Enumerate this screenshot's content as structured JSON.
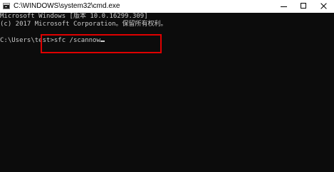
{
  "window": {
    "title": "C:\\WINDOWS\\system32\\cmd.exe"
  },
  "console": {
    "lines": [
      "Microsoft Windows [版本 10.0.16299.309]",
      "(c) 2017 Microsoft Corporation。保留所有权利。"
    ],
    "prompt": "C:\\Users\\test>",
    "command": "sfc /scannow"
  },
  "colors": {
    "console_bg": "#0c0c0c",
    "console_text": "#cccccc",
    "highlight_border": "#e00000",
    "titlebar_bg": "#ffffff"
  },
  "icons": {
    "app": "cmd-app-icon",
    "minimize": "minimize-icon",
    "maximize": "maximize-icon",
    "close": "close-icon"
  }
}
